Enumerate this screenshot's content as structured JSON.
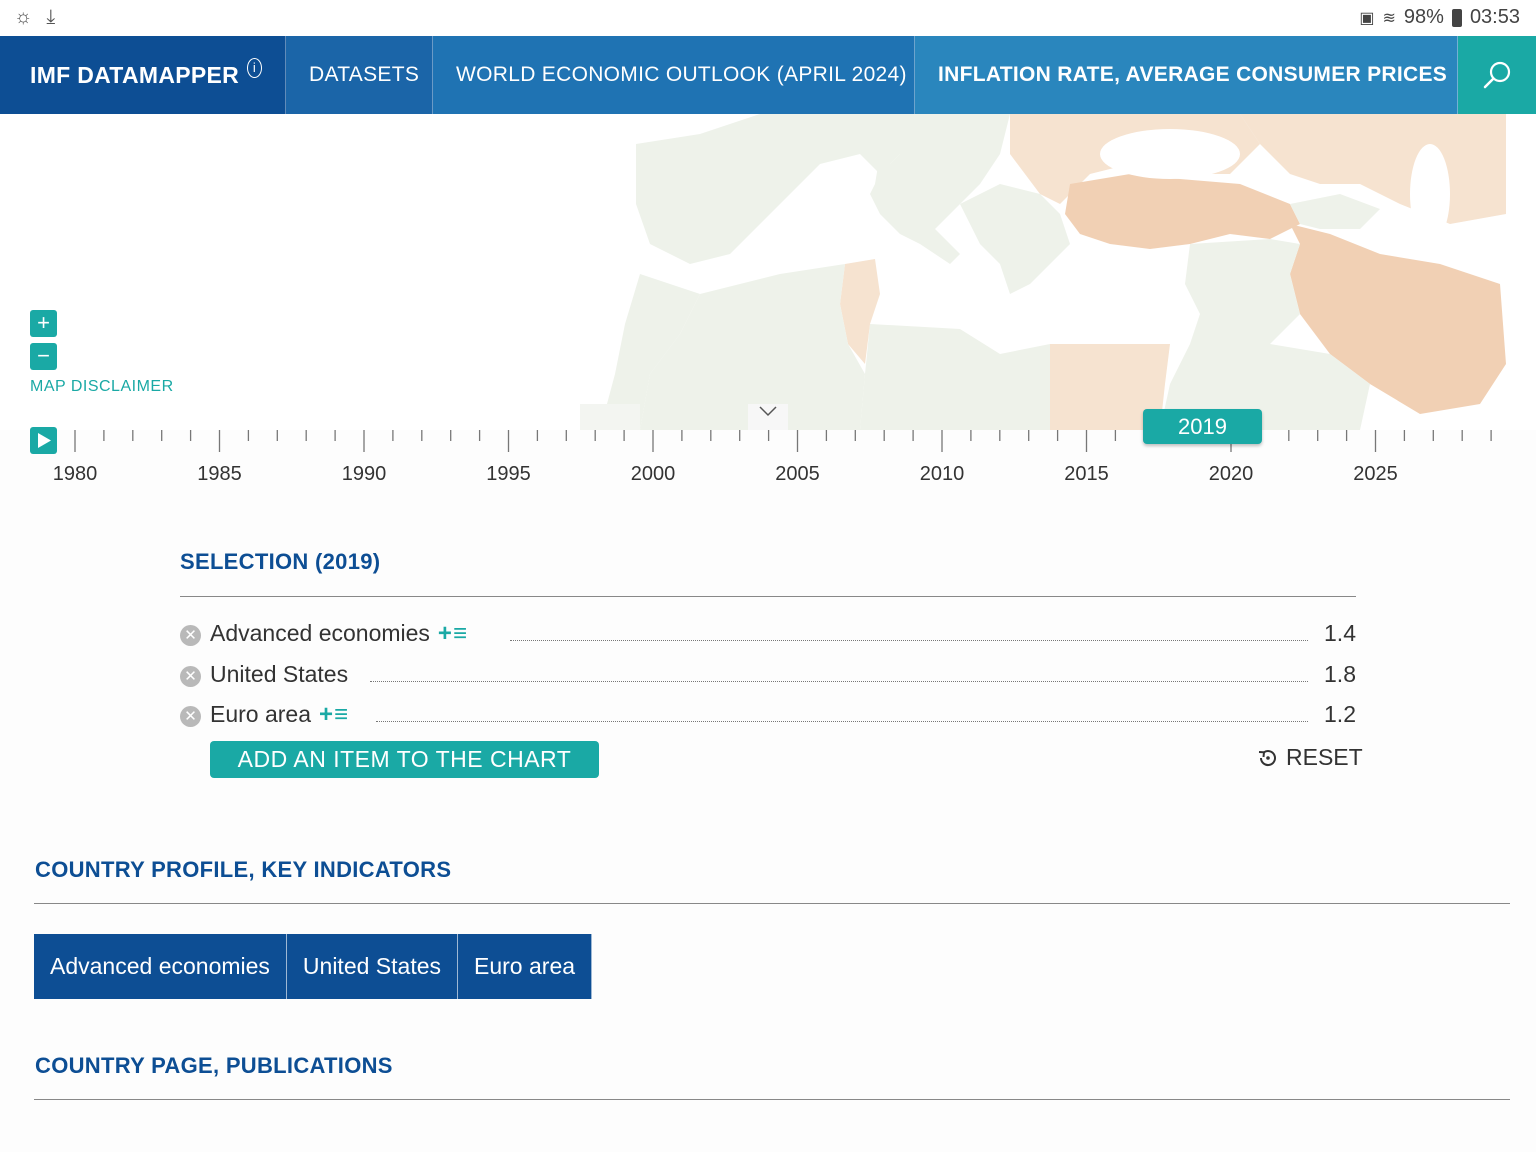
{
  "statusbar": {
    "left_icons": [
      "weather-icon",
      "download-icon"
    ],
    "battery": "98%",
    "time": "03:53"
  },
  "nav": {
    "brand": "IMF DATAMAPPER",
    "datasets": "DATASETS",
    "dataset_name": "WORLD ECONOMIC OUTLOOK (APRIL 2024)",
    "indicator": "INFLATION RATE, AVERAGE CONSUMER PRICES"
  },
  "map": {
    "disclaimer": "MAP DISCLAIMER",
    "colors": {
      "land_light": "#eef2ea",
      "land_peach": "#f6e3d0",
      "land_orange": "#f1d0b4",
      "water": "#ffffff"
    }
  },
  "timeline": {
    "selected_year": "2019",
    "labels": [
      "1980",
      "1985",
      "1990",
      "1995",
      "2000",
      "2005",
      "2010",
      "2015",
      "2020",
      "2025"
    ],
    "start_year": 1980,
    "end_year": 2029
  },
  "selection": {
    "title": "SELECTION (2019)",
    "rows": [
      {
        "name": "Advanced economies",
        "value": "1.4",
        "has_icon": true
      },
      {
        "name": "United States",
        "value": "1.8",
        "has_icon": false
      },
      {
        "name": "Euro area",
        "value": "1.2",
        "has_icon": true
      }
    ],
    "add_button": "ADD AN ITEM TO THE CHART",
    "reset": "RESET"
  },
  "profile": {
    "title": "COUNTRY PROFILE, KEY INDICATORS",
    "tabs": [
      "Advanced economies",
      "United States",
      "Euro area"
    ]
  },
  "publications": {
    "title": "COUNTRY PAGE, PUBLICATIONS"
  },
  "colors": {
    "brand_blue": "#0d4e94",
    "teal": "#1aa9a5"
  }
}
